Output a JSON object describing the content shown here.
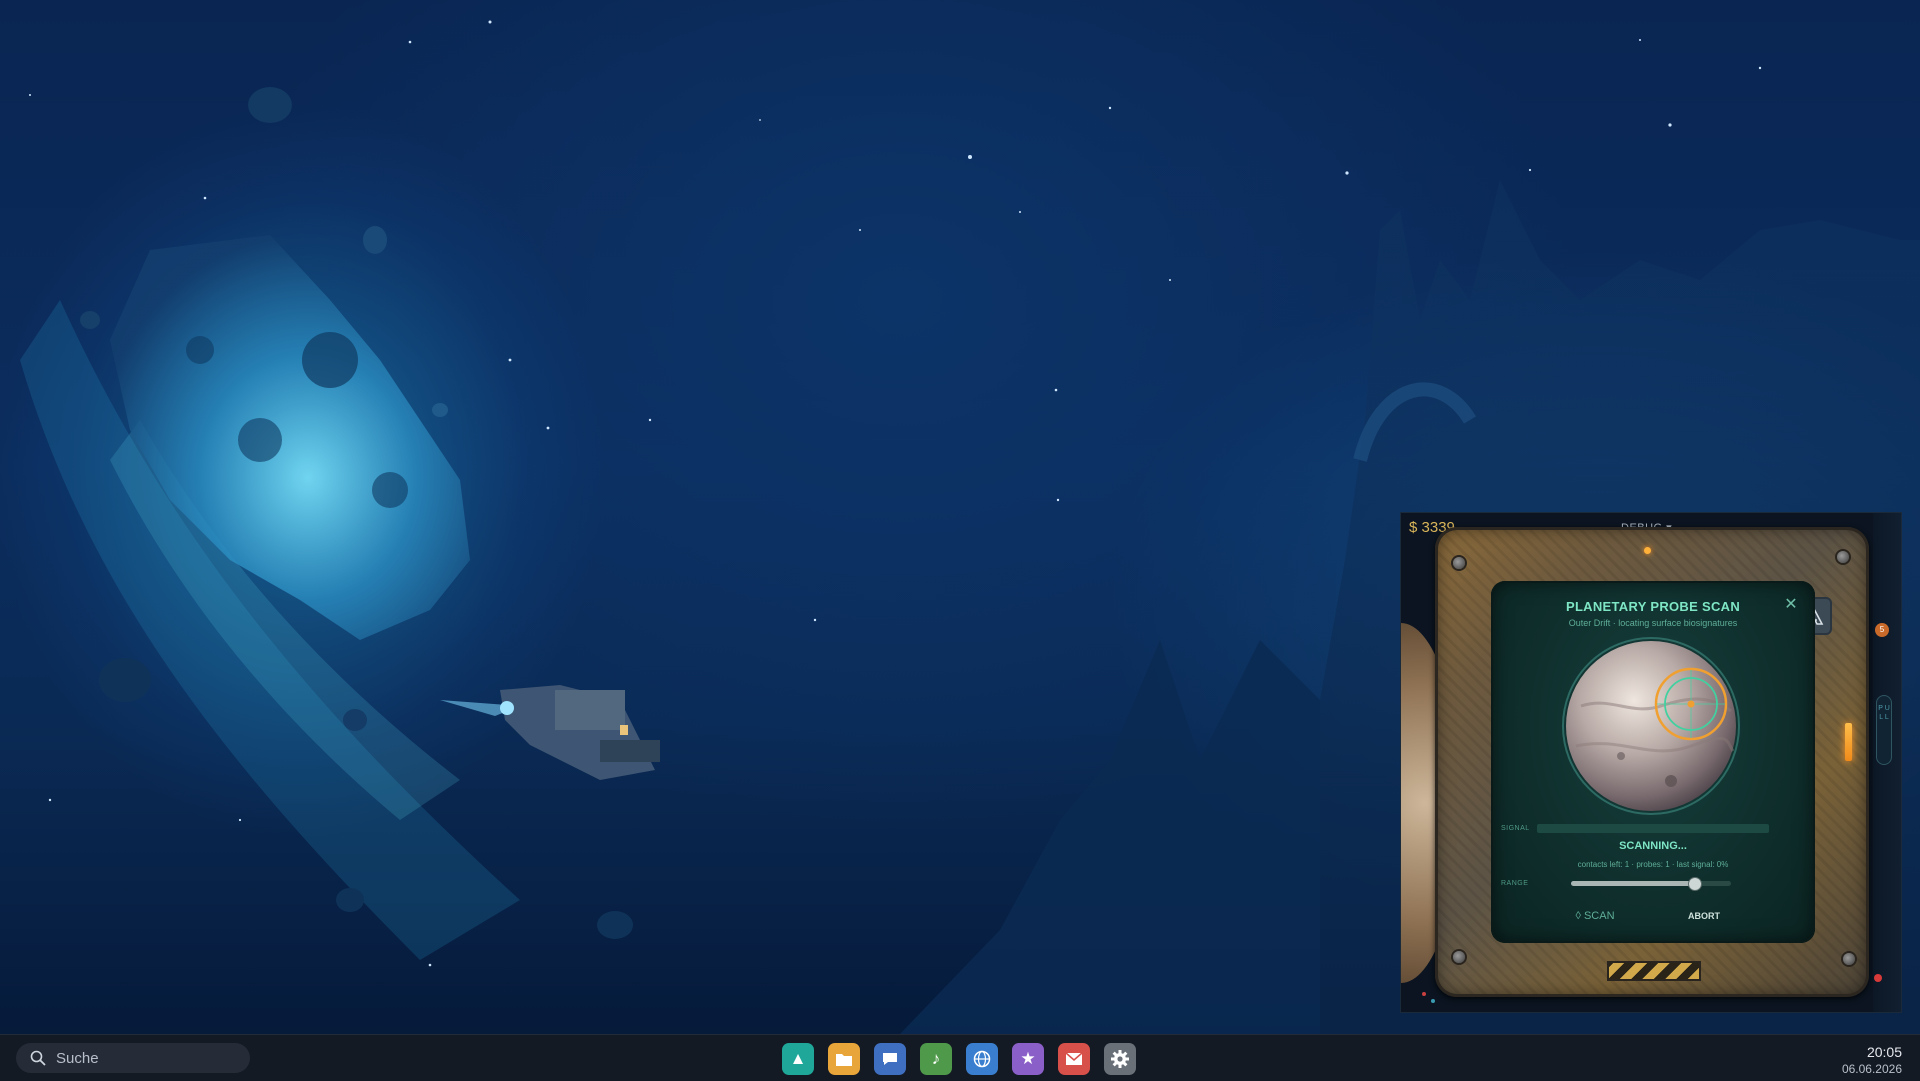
{
  "game": {
    "money": "$ 3339",
    "debug_label": "DEBUG ▾",
    "panel": {
      "title": "PLANETARY PROBE SCAN",
      "subtitle": "Outer Drift  ·  locating surface biosignatures",
      "signal_label": "SIGNAL",
      "signal_level_percent": 0,
      "status": "SCANNING...",
      "stats": "contacts left: 1   ·   probes: 1   ·   last signal: 0%",
      "range_label": "RANGE",
      "range_level_fraction": 0.77,
      "scan_button": "◊ SCAN",
      "abort_button": "ABORT"
    },
    "notification_badge": "5",
    "pull_tab": "P U L L"
  },
  "taskbar": {
    "search_placeholder": "Suche",
    "dock_apps": [
      {
        "name": "launcher",
        "icon": "▲",
        "color": "#1fa89a"
      },
      {
        "name": "files",
        "icon": "folder-icon",
        "color": "#e8a53a"
      },
      {
        "name": "chat",
        "icon": "chat-icon",
        "color": "#3f6fc0"
      },
      {
        "name": "music",
        "icon": "♪",
        "color": "#4f9a4a"
      },
      {
        "name": "browser",
        "icon": "globe-icon",
        "color": "#3a7fcf"
      },
      {
        "name": "favorites",
        "icon": "★",
        "color": "#8a5fc8"
      },
      {
        "name": "mail",
        "icon": "mail-icon",
        "color": "#d8504a"
      },
      {
        "name": "settings",
        "icon": "gear-icon",
        "color": "#6a7078"
      }
    ],
    "clock_time": "20:05",
    "clock_date": "06.06.2026"
  }
}
